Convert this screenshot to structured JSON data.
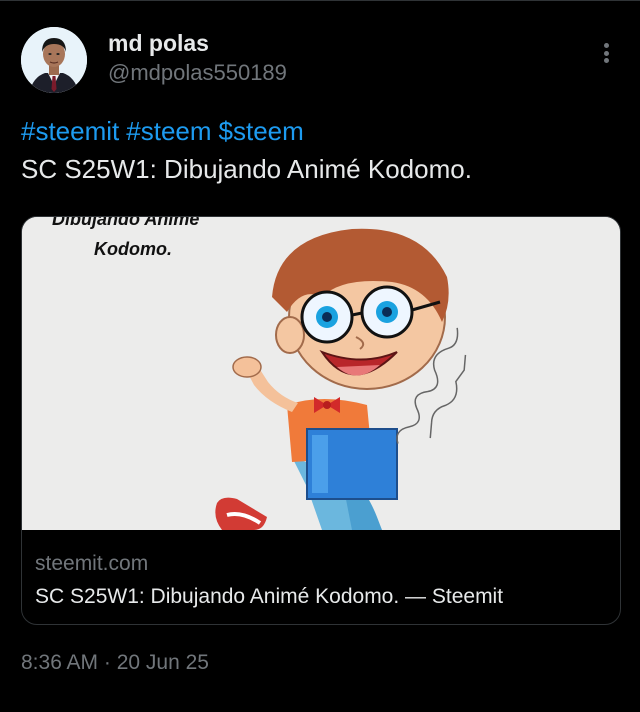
{
  "author": {
    "display_name": "md polas",
    "handle": "@mdpolas550189"
  },
  "tweet": {
    "tags": [
      "#steemit",
      "#steem",
      "$steem"
    ],
    "text": "SC S25W1: Dibujando Animé Kodomo."
  },
  "card": {
    "image_caption_line1": "Dibujando Animé",
    "image_caption_line2": "Kodomo.",
    "domain": "steemit.com",
    "title": "SC S25W1: Dibujando Animé Kodomo. — Steemit"
  },
  "timestamp": "8:36 AM · 20 Jun 25",
  "colors": {
    "background": "#000000",
    "text": "#e7e9ea",
    "muted": "#71767b",
    "link": "#1d9bf0",
    "border": "#2f3336"
  },
  "icons": {
    "more": "more-vertical-icon"
  }
}
